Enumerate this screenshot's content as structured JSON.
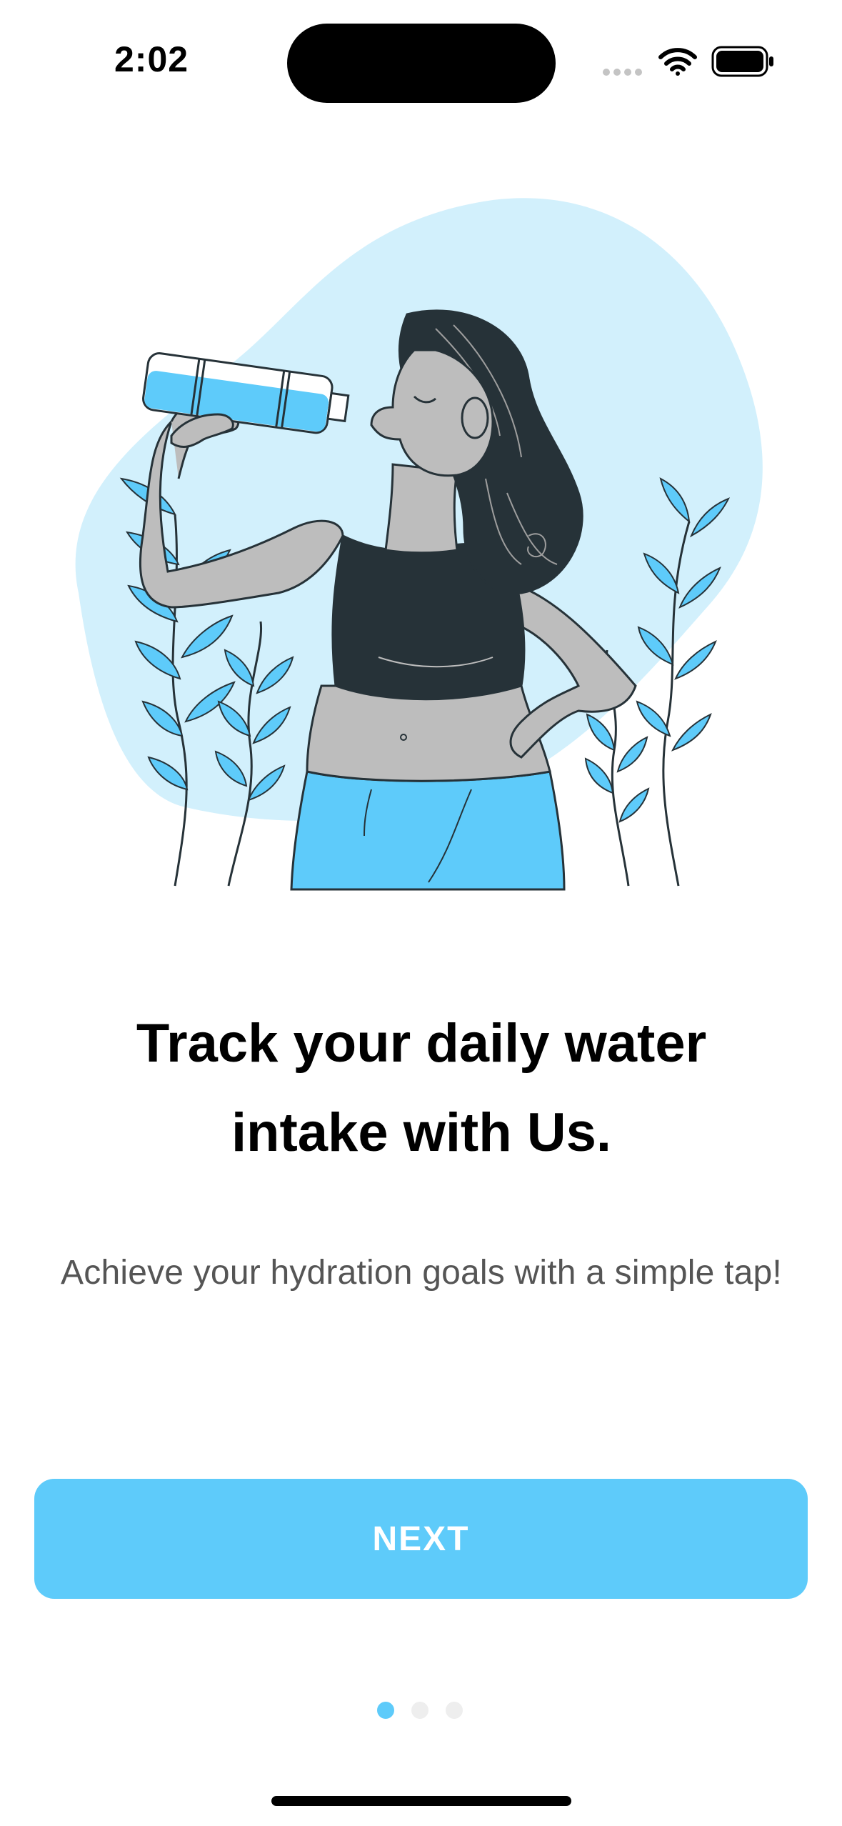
{
  "status_bar": {
    "time": "2:02"
  },
  "illustration": {
    "icon": "woman-drinking-water-illustration",
    "colors": {
      "blob": "#D2F0FC",
      "accent": "#5ECBFA",
      "skin": "#BDBDBD",
      "hair": "#263238"
    }
  },
  "onboarding": {
    "headline_line1": "Track your daily water",
    "headline_line2": "intake with Us.",
    "subtext": "Achieve your hydration goals with a simple tap!",
    "next_label": "NEXT",
    "page_count": 3,
    "active_page": 1
  },
  "colors": {
    "accent": "#5ECBFA",
    "text_primary": "#000000",
    "text_secondary": "#555555"
  }
}
